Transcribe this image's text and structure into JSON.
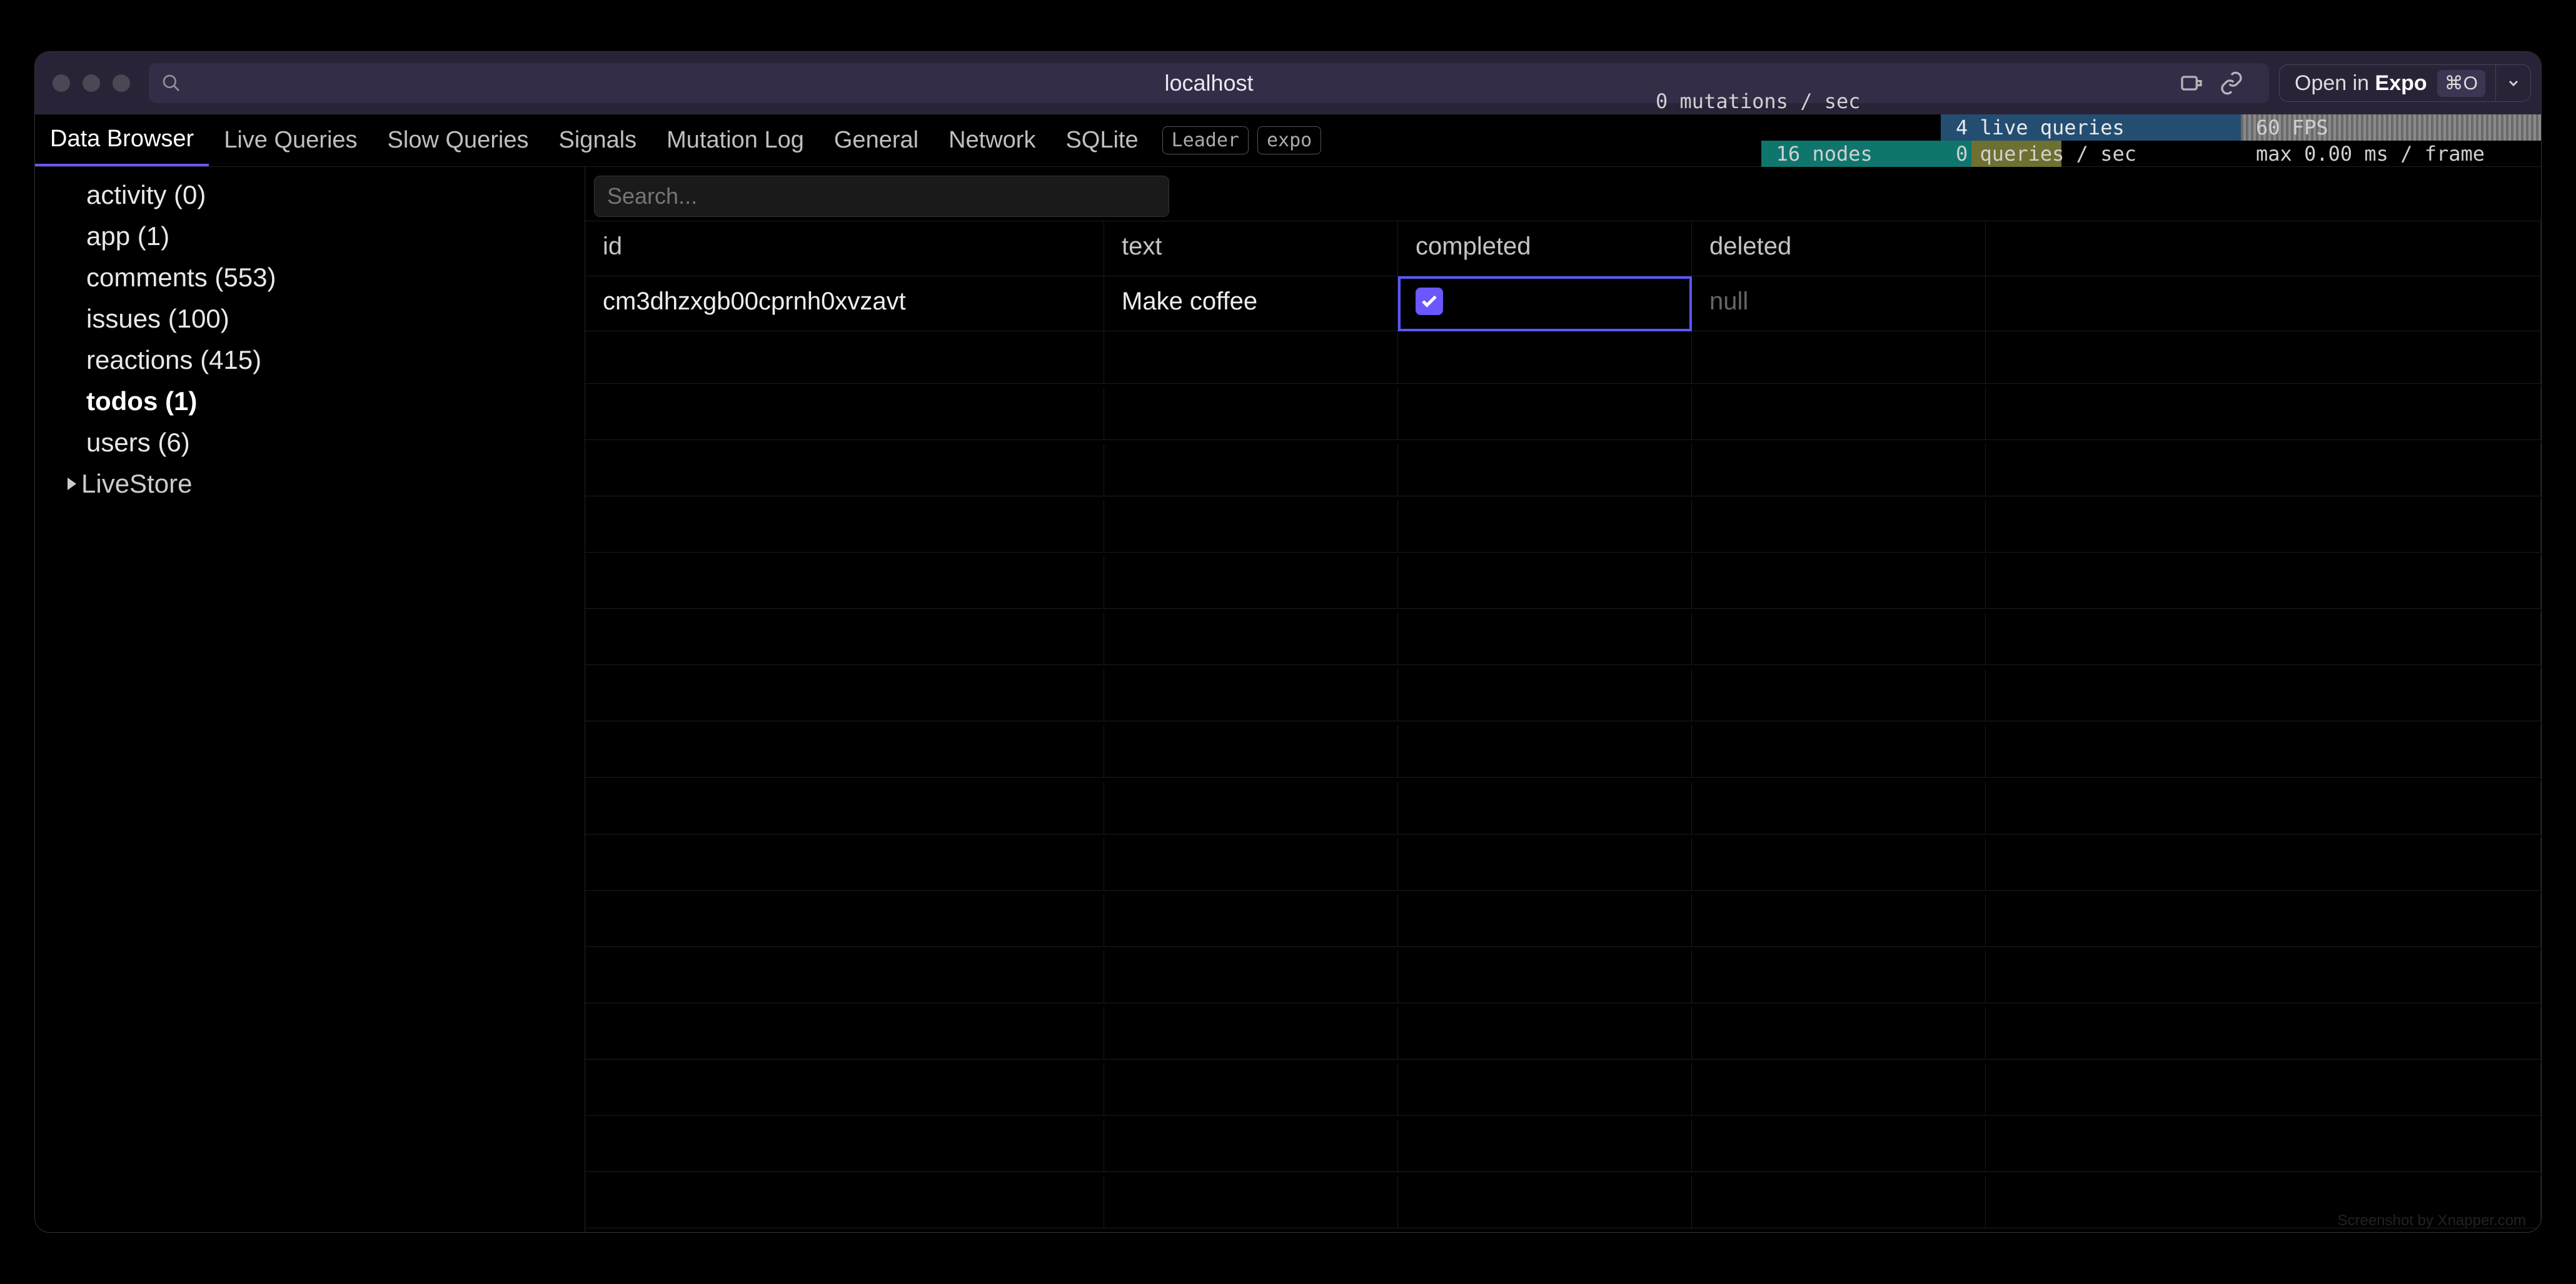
{
  "titlebar": {
    "title": "localhost",
    "open_in_label_prefix": "Open in ",
    "open_in_label_bold": "Expo",
    "shortcut": "⌘O"
  },
  "tabs": [
    {
      "label": "Data Browser",
      "active": true
    },
    {
      "label": "Live Queries"
    },
    {
      "label": "Slow Queries"
    },
    {
      "label": "Signals"
    },
    {
      "label": "Mutation Log"
    },
    {
      "label": "General"
    },
    {
      "label": "Network"
    },
    {
      "label": "SQLite"
    }
  ],
  "tab_pills": [
    "Leader",
    "expo"
  ],
  "stats": {
    "mutations": "0 mutations / sec",
    "nodes": "16 nodes",
    "live_queries": "4 live queries",
    "queries": "0 queries / sec",
    "fps": "60 FPS",
    "frame": "max 0.00 ms / frame"
  },
  "sidebar": {
    "tables": [
      {
        "name": "activity",
        "count": 0
      },
      {
        "name": "app",
        "count": 1
      },
      {
        "name": "comments",
        "count": 553
      },
      {
        "name": "issues",
        "count": 100
      },
      {
        "name": "reactions",
        "count": 415
      },
      {
        "name": "todos",
        "count": 1,
        "selected": true
      },
      {
        "name": "users",
        "count": 6
      }
    ],
    "groups": [
      "LiveStore"
    ]
  },
  "search": {
    "placeholder": "Search..."
  },
  "columns": [
    "id",
    "text",
    "completed",
    "deleted"
  ],
  "rows": [
    {
      "id": "cm3dhzxgb00cprnh0xvzavt",
      "text": "Make coffee",
      "completed": true,
      "deleted": null
    }
  ],
  "watermark": "Screenshot by Xnapper.com"
}
